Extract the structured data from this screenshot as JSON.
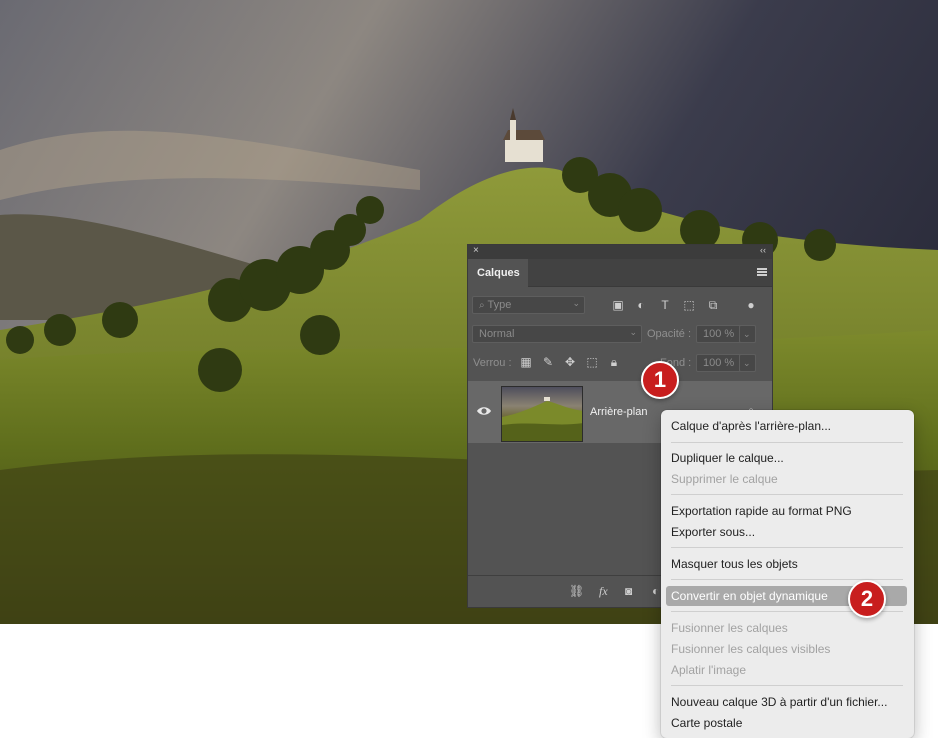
{
  "panel": {
    "close_glyph": "×",
    "collapse_glyph": "‹‹",
    "tab_label": "Calques",
    "filter": {
      "placeholder": "Type",
      "icons": [
        "image-filter-icon",
        "adjustment-filter-icon",
        "type-filter-icon",
        "shape-filter-icon",
        "smart-object-filter-icon",
        "filter-toggle-icon"
      ]
    },
    "blend_mode": "Normal",
    "opacity_label": "Opacité :",
    "opacity_value": "100 %",
    "lock_label": "Verrou :",
    "fill_label": "Fond :",
    "fill_value": "100 %",
    "layer": {
      "name": "Arrière-plan",
      "visible": true,
      "locked": true
    },
    "footer_icons": [
      "link-layers-icon",
      "fx-icon",
      "add-mask-icon",
      "adjustment-layer-icon"
    ],
    "fx_text": "fx"
  },
  "context_menu": {
    "items": [
      {
        "label": "Calque d'après l'arrière-plan...",
        "enabled": true
      },
      {
        "label": "Dupliquer le calque...",
        "enabled": true
      },
      {
        "label": "Supprimer le calque",
        "enabled": false
      },
      {
        "label": "Exportation rapide au format PNG",
        "enabled": true
      },
      {
        "label": "Exporter sous...",
        "enabled": true
      },
      {
        "label": "Masquer tous les objets",
        "enabled": true
      },
      {
        "label": "Convertir en objet dynamique",
        "enabled": true,
        "highlighted": true
      },
      {
        "label": "Fusionner les calques",
        "enabled": false
      },
      {
        "label": "Fusionner les calques visibles",
        "enabled": false
      },
      {
        "label": "Aplatir l'image",
        "enabled": false
      },
      {
        "label": "Nouveau calque 3D à partir d'un fichier...",
        "enabled": true
      },
      {
        "label": "Carte postale",
        "enabled": true
      }
    ]
  },
  "callouts": [
    {
      "number": "1"
    },
    {
      "number": "2"
    }
  ],
  "colors": {
    "callout_red": "#c81e1e",
    "panel_bg": "#535353",
    "menu_bg": "#ececec",
    "highlight": "#a9a9a9"
  }
}
